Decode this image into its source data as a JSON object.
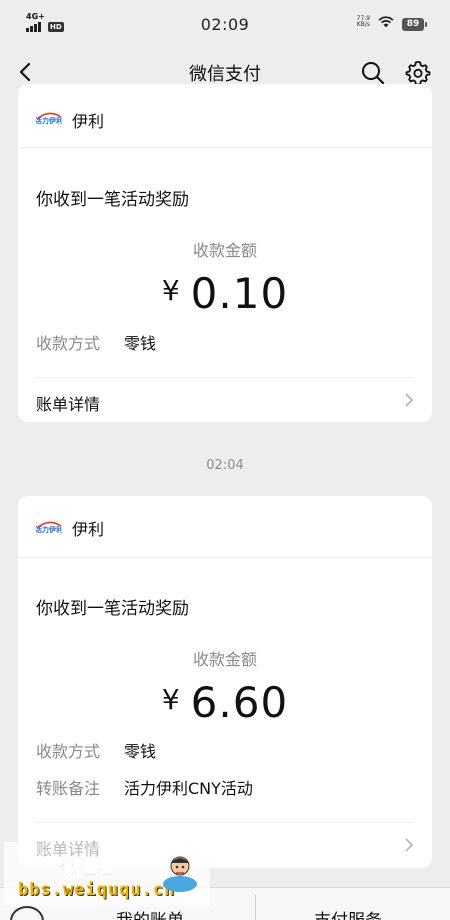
{
  "status_bar": {
    "network": "4G+",
    "hd": "HD",
    "time": "02:09",
    "speed_value": "77.9",
    "speed_unit": "KB/s",
    "battery": "89"
  },
  "nav": {
    "title": "微信支付",
    "back_icon": "chevron-left-icon",
    "search_icon": "search-icon",
    "settings_icon": "gear-icon"
  },
  "messages": [
    {
      "merchant": "伊利",
      "title": "你收到一笔活动奖励",
      "amount_label": "收款金额",
      "currency": "¥",
      "amount": "0.10",
      "rows": [
        {
          "key": "收款方式",
          "value": "零钱"
        }
      ],
      "detail": "账单详情"
    },
    {
      "merchant": "伊利",
      "title": "你收到一笔活动奖励",
      "amount_label": "收款金额",
      "currency": "¥",
      "amount": "6.60",
      "rows": [
        {
          "key": "收款方式",
          "value": "零钱"
        },
        {
          "key": "转账备注",
          "value": "活力伊利CNY活动"
        }
      ],
      "detail": "账单详情"
    }
  ],
  "time_separator": "02:04",
  "bottom_bar": {
    "left": "我的账单",
    "right": "支付服务"
  },
  "watermark": {
    "name": "微趣趣",
    "url": "bbs.weiququ.cn"
  },
  "colors": {
    "background": "#ededed",
    "card": "#ffffff",
    "muted_text": "#8a8a8a",
    "logo_blue": "#1f6fd1",
    "logo_red": "#e03a2f"
  }
}
